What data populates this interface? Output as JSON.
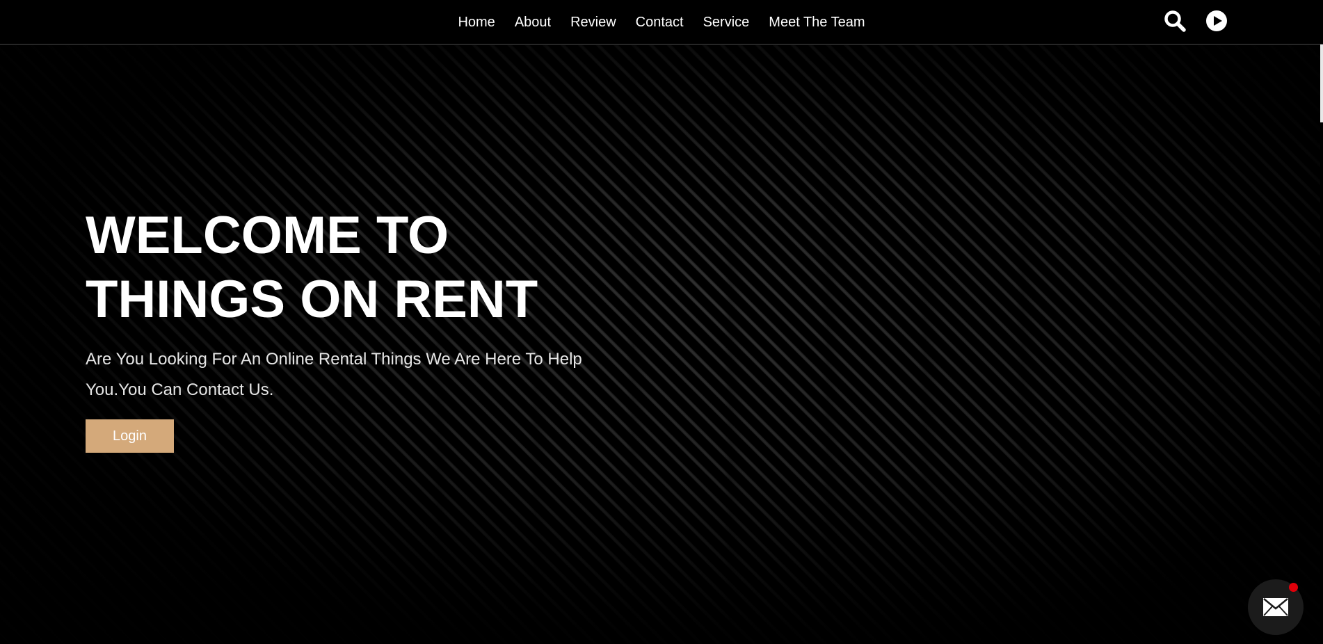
{
  "nav": {
    "items": [
      {
        "label": "Home"
      },
      {
        "label": "About"
      },
      {
        "label": "Review"
      },
      {
        "label": "Contact"
      },
      {
        "label": "Service"
      },
      {
        "label": "Meet The Team"
      }
    ]
  },
  "header_icons": {
    "search": "search-icon",
    "play": "play-circle-icon"
  },
  "hero": {
    "title_line1": "WELCOME TO",
    "title_line2": "THINGS ON RENT",
    "subtitle_line1": "Are You Looking For An Online Rental Things We Are Here To Help",
    "subtitle_line2": "You.You Can Contact Us.",
    "login_label": "Login"
  },
  "chat": {
    "icon": "envelope-icon"
  },
  "colors": {
    "background": "#000000",
    "accent": "#d4a97a",
    "notification": "#e0000a",
    "text": "#ffffff"
  }
}
